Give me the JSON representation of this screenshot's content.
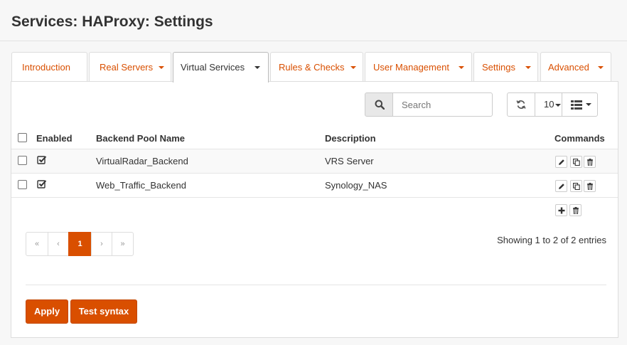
{
  "page": {
    "title": "Services: HAProxy: Settings"
  },
  "tabs": [
    {
      "label": "Introduction",
      "has_dropdown": false,
      "active": false
    },
    {
      "label": "Real Servers",
      "has_dropdown": true,
      "active": false
    },
    {
      "label": "Virtual Services",
      "has_dropdown": true,
      "active": true
    },
    {
      "label": "Rules & Checks",
      "has_dropdown": true,
      "active": false
    },
    {
      "label": "User Management",
      "has_dropdown": true,
      "active": false
    },
    {
      "label": "Settings",
      "has_dropdown": true,
      "active": false
    },
    {
      "label": "Advanced",
      "has_dropdown": true,
      "active": false
    }
  ],
  "toolbar": {
    "search_placeholder": "Search",
    "search_icon": "search-icon",
    "refresh_icon": "refresh-icon",
    "page_size": "10",
    "columns_icon": "columns-list-icon"
  },
  "table": {
    "columns": [
      "Enabled",
      "Backend Pool Name",
      "Description",
      "Commands"
    ],
    "rows": [
      {
        "enabled": true,
        "name": "VirtualRadar_Backend",
        "description": "VRS Server"
      },
      {
        "enabled": true,
        "name": "Web_Traffic_Backend",
        "description": "Synology_NAS"
      }
    ]
  },
  "pagination": {
    "first": "«",
    "prev": "‹",
    "current": "1",
    "next": "›",
    "last": "»",
    "showing": "Showing 1 to 2 of 2 entries"
  },
  "actions": {
    "apply": "Apply",
    "test_syntax": "Test syntax"
  },
  "colors": {
    "accent": "#d94f00"
  }
}
